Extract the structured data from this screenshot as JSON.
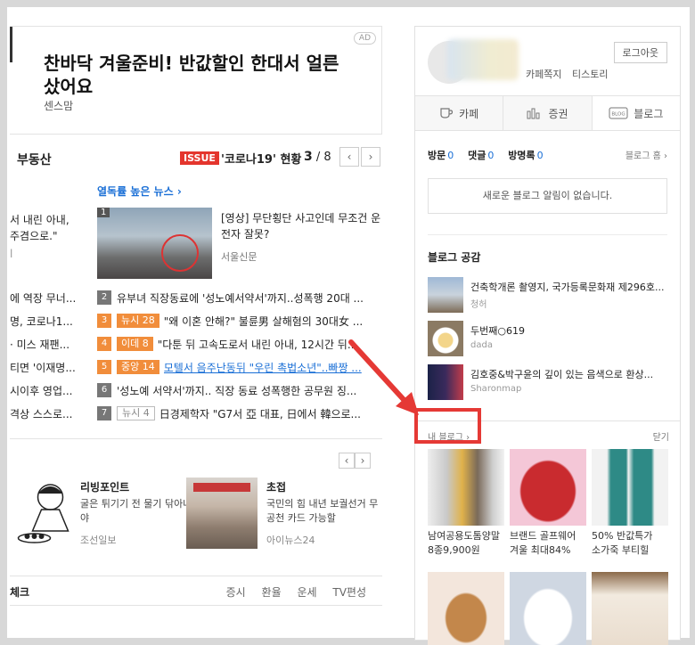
{
  "ad": {
    "tag": "AD",
    "title": "찬바닥 겨울준비! 반값할인 한대서 얼른 샀어요",
    "source": "센스맘"
  },
  "news": {
    "category": "부동산",
    "issue_badge": "ISSUE",
    "issue_title": "'코로나19' 현황",
    "page_current": "3",
    "page_total": "/ 8",
    "prev": "‹",
    "next": "›",
    "hot_link": "열독률 높은 뉴스 ›",
    "left_snippets": [
      "서 내린 아내,",
      "주겸으로.\"",
      "l",
      "에 역장 무너...",
      "명, 코로나1...",
      "· 미스 재팬...",
      "티면 '이재명...",
      "시이후 영업...",
      "격상 스스로..."
    ],
    "feature": {
      "num": "1",
      "title": "[영상] 무단횡단 사고인데 무조건 운전자 잘못?",
      "source": "서울신문"
    },
    "ranks": [
      {
        "num": "2",
        "badge": "",
        "text": "유부녀 직장동료에 '성노예서약서'까지..성폭행 20대 ..."
      },
      {
        "num": "3",
        "badge": "뉴시 28",
        "text": "\"왜 이혼 안해?\" 불륜男 살해혐의 30대女 ..."
      },
      {
        "num": "4",
        "badge": "이데 8",
        "text": "\"다툰 뒤 고속도로서 내린 아내, 12시간 뒤..."
      },
      {
        "num": "5",
        "badge": "중앙 14",
        "text": "모텔서 음주난동뒤 \"우린 촉법소년\"..빠짱 ..."
      },
      {
        "num": "6",
        "badge": "",
        "text": "'성노예 서약서'까지.. 직장 동료 성폭행한 공무원 징..."
      },
      {
        "num": "7",
        "badge": "뉴시 4",
        "text": "日경제학자 \"G7서 亞 대표, 日에서 韓으로..."
      }
    ]
  },
  "sub": {
    "prev": "‹",
    "next": "›",
    "cards": [
      {
        "title": "리빙포인트",
        "desc": "굴은 튀기기 전 물기 닦아내야",
        "source": "조선일보"
      },
      {
        "title": "초접",
        "desc": "국민의 힘 내년 보궐선거 무공천 카드 가능할",
        "source": "아이뉴스24"
      }
    ]
  },
  "bottom": {
    "left": "체크",
    "links": [
      "증시",
      "환율",
      "운세",
      "TV편성"
    ]
  },
  "panel": {
    "logout": "로그아웃",
    "links": [
      "카페쪽지",
      "티스토리"
    ],
    "tabs": [
      {
        "icon": "cup-icon",
        "label": "카페"
      },
      {
        "icon": "stock-icon",
        "label": "증권"
      },
      {
        "icon": "blog-icon",
        "label": "블로그"
      }
    ],
    "stats": [
      {
        "label": "방문",
        "count": "0"
      },
      {
        "label": "댓글",
        "count": "0"
      },
      {
        "label": "방명록",
        "count": "0"
      }
    ],
    "blog_home": "블로그 홈 ›",
    "notice": "새로운 블로그 알림이 없습니다.",
    "sympathy_title": "블로그 공감",
    "blogs": [
      {
        "title": "건축학개론 촬영지, 국가등록문화재 제296호...",
        "source": "청허"
      },
      {
        "title": "두번째○619",
        "source": "dada"
      },
      {
        "title": "김호중&박구윤의 깊이 있는 음색으로 환상...",
        "source": "Sharonmap"
      }
    ],
    "my_blog": "내 블로그 ›",
    "close": "닫기",
    "shop": [
      {
        "text1": "남여공용도톰양말",
        "text2": "8종9,900원"
      },
      {
        "text1": "브랜드 골프웨어",
        "text2": "겨울 최대84%"
      },
      {
        "text1": "50% 반값특가",
        "text2": "소가죽 부티힐"
      }
    ]
  }
}
